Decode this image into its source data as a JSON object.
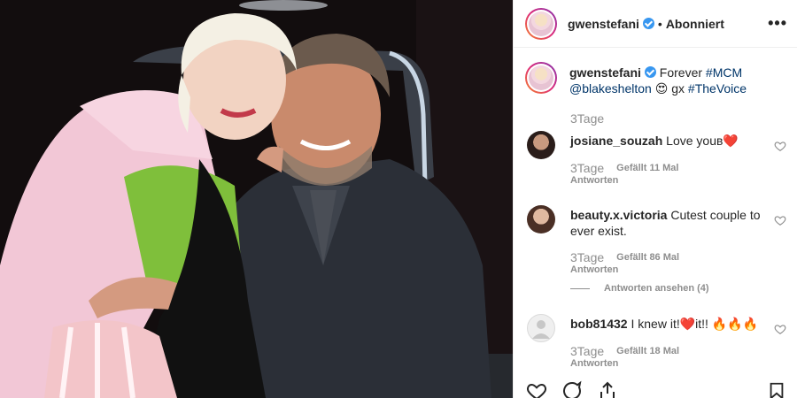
{
  "post": {
    "username": "gwenstefani",
    "follow_state": "Abonniert",
    "separator": "•",
    "more": "•••"
  },
  "caption": {
    "username": "gwenstefani",
    "text_1": "Forever",
    "tag_mcm": "#MCM",
    "mention": "@blakeshelton",
    "emoji": "😍",
    "text_2": "gx",
    "tag_voice": "#TheVoice",
    "time": "3Tage"
  },
  "comments": [
    {
      "username": "josiane_souzah",
      "text": "Love youʙ❤️",
      "time": "3Tage",
      "likes": "Gefällt 11 Mal",
      "reply": "Antworten"
    },
    {
      "username": "beauty.x.victoria",
      "text": "Cutest couple to ever exist.",
      "time": "3Tage",
      "likes": "Gefällt 86 Mal",
      "reply": "Antworten",
      "view_replies": "Antworten ansehen (4)"
    },
    {
      "username": "bob81432",
      "text": "I knew it!❤️it!! 🔥🔥🔥",
      "time": "3Tage",
      "likes": "Gefällt 18 Mal",
      "reply": "Antworten"
    }
  ],
  "icons": [
    "heart-icon",
    "comment-icon",
    "share-icon",
    "bookmark-icon",
    "verified-badge-icon"
  ],
  "colors": {
    "verified": "#3897f0",
    "link": "#003569",
    "muted": "#8e8e8e",
    "text": "#262626"
  }
}
